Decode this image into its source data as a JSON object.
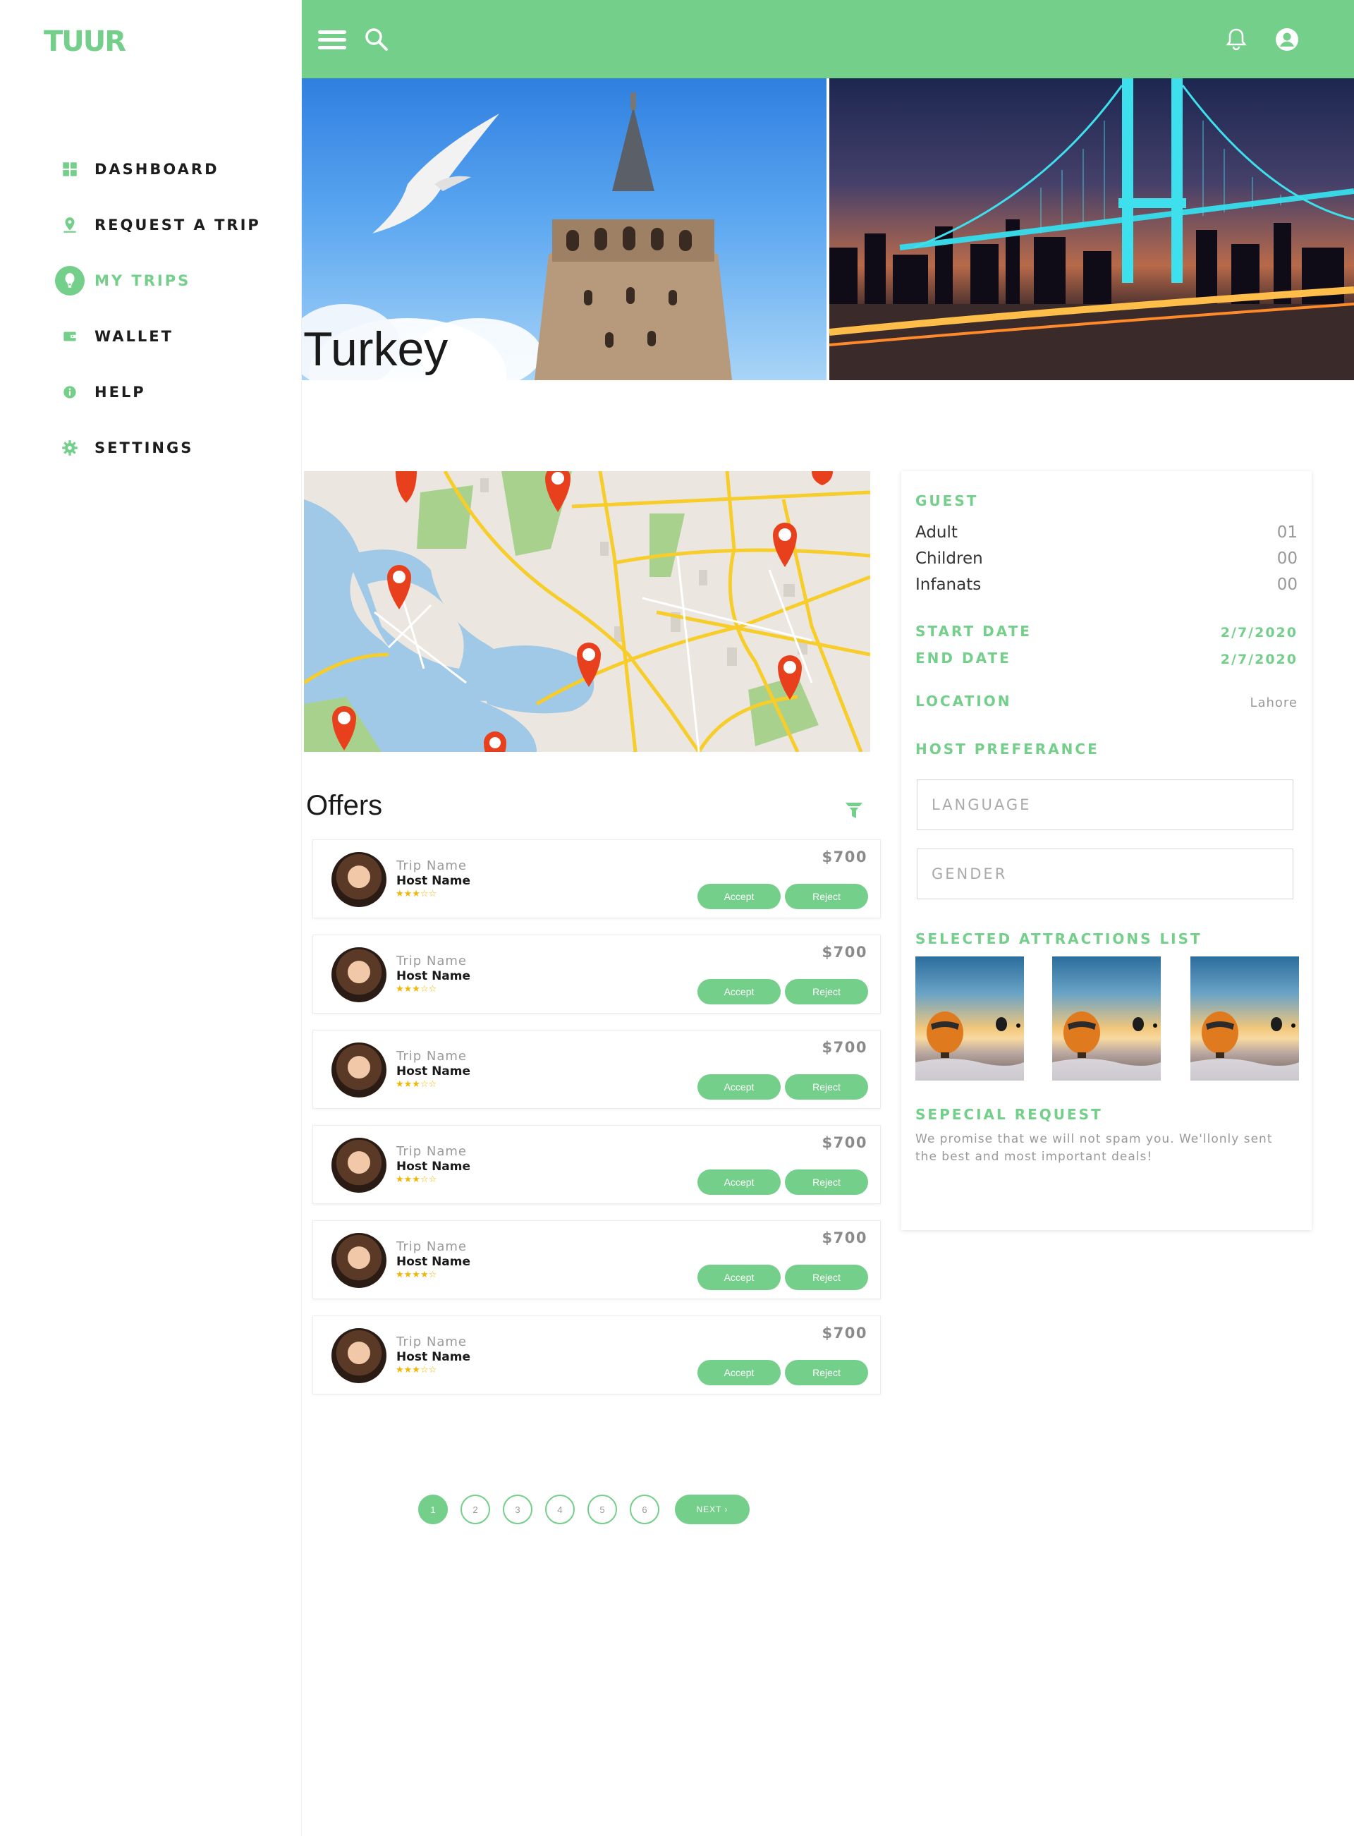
{
  "app": {
    "logo": "TUUR"
  },
  "sidebar": {
    "items": [
      {
        "label": "DASHBOARD",
        "icon": "dashboard-icon",
        "active": false
      },
      {
        "label": "REQUEST A TRIP",
        "icon": "location-pin-icon",
        "active": false
      },
      {
        "label": "MY TRIPS",
        "icon": "balloon-icon",
        "active": true
      },
      {
        "label": "WALLET",
        "icon": "wallet-icon",
        "active": false
      },
      {
        "label": "HELP",
        "icon": "info-icon",
        "active": false
      },
      {
        "label": "SETTINGS",
        "icon": "gear-icon",
        "active": false
      }
    ]
  },
  "topbar": {
    "icons": [
      "menu-icon",
      "search-icon",
      "bell-icon",
      "user-icon"
    ]
  },
  "hero": {
    "title": "Turkey"
  },
  "offers": {
    "title": "Offers",
    "items": [
      {
        "trip_name": "Trip Name",
        "host_name": "Host Name",
        "rating": "★★★☆☆",
        "price": "$700",
        "accept": "Accept",
        "reject": "Reject"
      },
      {
        "trip_name": "Trip Name",
        "host_name": "Host Name",
        "rating": "★★★☆☆",
        "price": "$700",
        "accept": "Accept",
        "reject": "Reject"
      },
      {
        "trip_name": "Trip Name",
        "host_name": "Host Name",
        "rating": "★★★☆☆",
        "price": "$700",
        "accept": "Accept",
        "reject": "Reject"
      },
      {
        "trip_name": "Trip Name",
        "host_name": "Host Name",
        "rating": "★★★☆☆",
        "price": "$700",
        "accept": "Accept",
        "reject": "Reject"
      },
      {
        "trip_name": "Trip Name",
        "host_name": "Host Name",
        "rating": "★★★★☆",
        "price": "$700",
        "accept": "Accept",
        "reject": "Reject"
      },
      {
        "trip_name": "Trip Name",
        "host_name": "Host Name",
        "rating": "★★★☆☆",
        "price": "$700",
        "accept": "Accept",
        "reject": "Reject"
      }
    ]
  },
  "pagination": {
    "pages": [
      "1",
      "2",
      "3",
      "4",
      "5",
      "6"
    ],
    "current": "1",
    "next": "NEXT ›"
  },
  "details": {
    "guest_heading": "GUEST",
    "adult_label": "Adult",
    "adult_value": "01",
    "children_label": "Children",
    "children_value": "00",
    "infants_label": "Infanats",
    "infants_value": "00",
    "start_label": "START DATE",
    "start_value": "2/7/2020",
    "end_label": "END DATE",
    "end_value": "2/7/2020",
    "location_label": "LOCATION",
    "location_value": "Lahore",
    "host_pref_heading": "HOST PREFERANCE",
    "language_placeholder": "LANGUAGE",
    "gender_placeholder": "GENDER",
    "attractions_heading": "SELECTED ATTRACTIONS LIST",
    "special_heading": "SEPECIAL REQUEST",
    "special_text": "We promise that we will not spam you. We'llonly sent the best and most important deals!"
  },
  "colors": {
    "accent": "#74cf8a",
    "star": "#f2b705",
    "pin": "#e8401c"
  }
}
